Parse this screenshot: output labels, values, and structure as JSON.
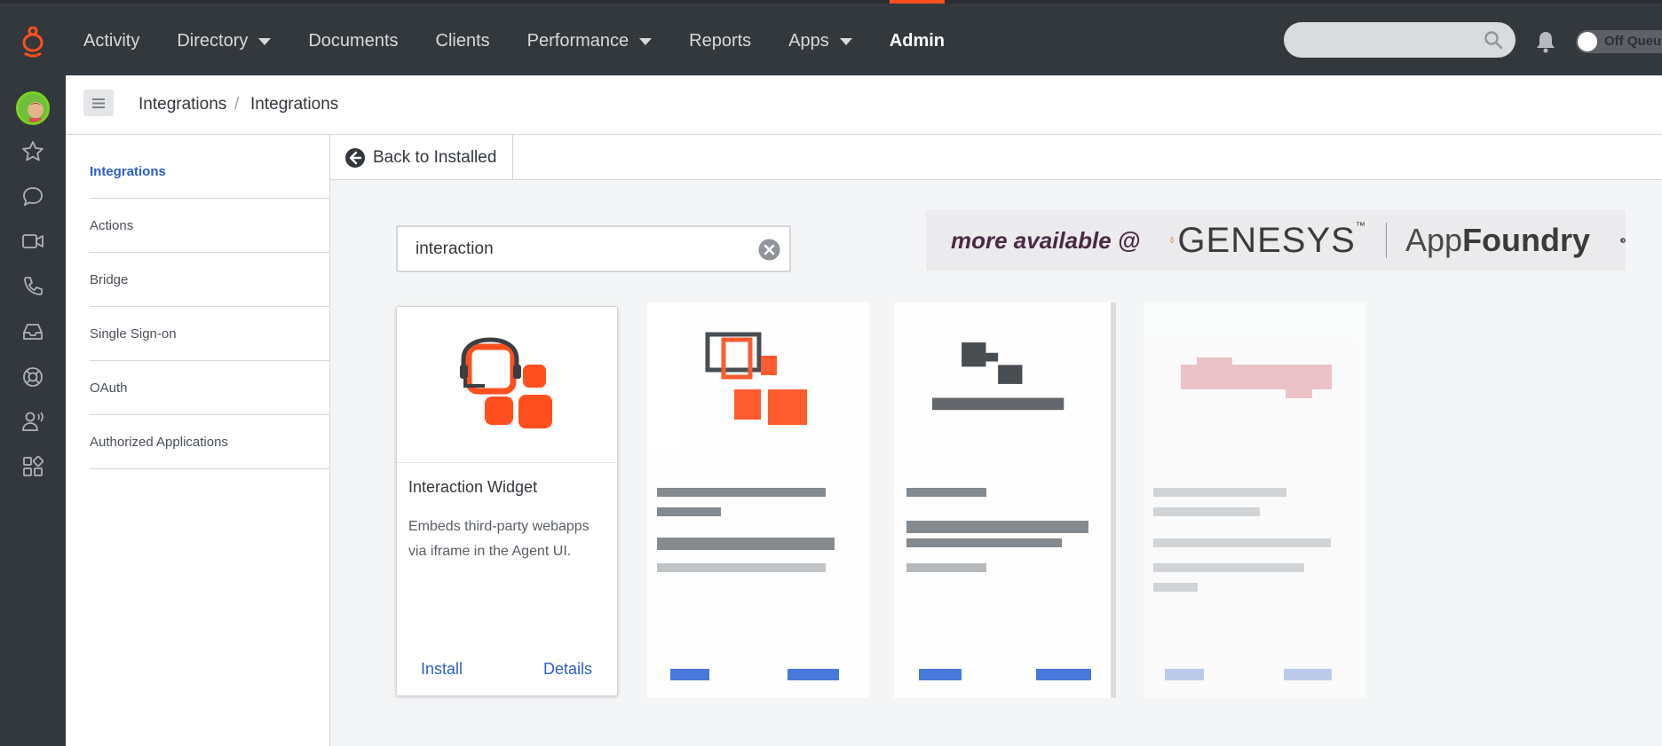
{
  "topnav": {
    "items": [
      {
        "label": "Activity",
        "has_caret": false
      },
      {
        "label": "Directory",
        "has_caret": true
      },
      {
        "label": "Documents",
        "has_caret": false
      },
      {
        "label": "Clients",
        "has_caret": false
      },
      {
        "label": "Performance",
        "has_caret": true
      },
      {
        "label": "Reports",
        "has_caret": false
      },
      {
        "label": "Apps",
        "has_caret": true
      },
      {
        "label": "Admin",
        "has_caret": false,
        "active": true
      }
    ],
    "search_value": "",
    "presence_label": "Off Queue"
  },
  "rail": {
    "icons": [
      "star-icon",
      "chat-icon",
      "video-icon",
      "phone-icon",
      "inbox-icon",
      "support-icon",
      "user-voice-icon",
      "apps-icon"
    ]
  },
  "breadcrumb": {
    "first": "Integrations",
    "separator": "/",
    "second": "Integrations"
  },
  "sidemenu": {
    "items": [
      "Integrations",
      "Actions",
      "Bridge",
      "Single Sign-on",
      "OAuth",
      "Authorized Applications"
    ],
    "active_index": 0
  },
  "toolbar": {
    "back_label": "Back to Installed"
  },
  "filter": {
    "value": "interaction"
  },
  "banner": {
    "more": "more available @",
    "brand": "GENESYS",
    "tm": "™",
    "app_prefix": "App",
    "app_suffix": "Foundry"
  },
  "cards": [
    {
      "title": "Interaction Widget",
      "description": "Embeds third-party webapps via iframe in the Agent UI.",
      "install_label": "Install",
      "details_label": "Details"
    }
  ],
  "colors": {
    "brand_orange": "#ff4f1f",
    "nav_bg": "#33383d",
    "link_blue": "#2a60c8"
  }
}
